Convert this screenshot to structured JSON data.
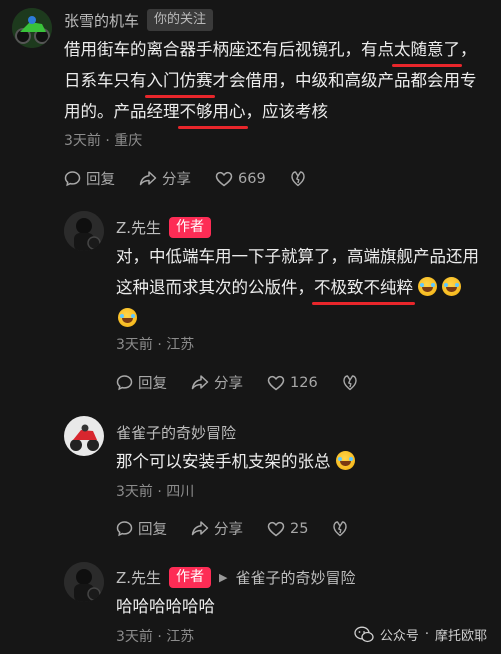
{
  "comments": [
    {
      "author": "张雪的机车",
      "badge": "你的关注",
      "body": {
        "l1a": "借用街车的离合器手柄座还有后视镜孔，有点",
        "l1h": "太随意了",
        "l1b": "，",
        "l2a": "日系车只有",
        "l2h": "入门仿赛",
        "l2b": "才会借用，中级和高级产品都会用专",
        "l3a": "用的。产品经理",
        "l3h": "不够用心",
        "l3b": "，应该考核"
      },
      "meta": "3天前 · 重庆",
      "actions": {
        "reply": "回复",
        "share": "分享",
        "likes": "669"
      }
    },
    {
      "author": "Z.先生",
      "badge": "作者",
      "body": {
        "l1": "对，中低端车用一下子就算了，高端旗舰产品还用",
        "l2a": "这种退而求其次的公版件，",
        "l2h": "不极致不纯粹"
      },
      "meta": "3天前 · 江苏",
      "actions": {
        "reply": "回复",
        "share": "分享",
        "likes": "126"
      }
    },
    {
      "author": "雀雀子的奇妙冒险",
      "body": {
        "l1": "那个可以安装手机支架的张总"
      },
      "meta": "3天前 · 四川",
      "actions": {
        "reply": "回复",
        "share": "分享",
        "likes": "25"
      }
    },
    {
      "author": "Z.先生",
      "badge": "作者",
      "reply_to": "雀雀子的奇妙冒险",
      "body": {
        "l1": "哈哈哈哈哈哈"
      },
      "meta": "3天前 · 江苏"
    }
  ],
  "watermark": {
    "channel": "公众号",
    "name": "摩托欧耶"
  },
  "icons": [
    "reply-bubble-icon",
    "share-arrow-icon",
    "heart-icon",
    "dislike-icon",
    "laugh-cry-emoji",
    "wechat-icon"
  ],
  "colors": {
    "background": "#161616",
    "author_badge": "#fe2c55",
    "underline": "#e8262b"
  }
}
